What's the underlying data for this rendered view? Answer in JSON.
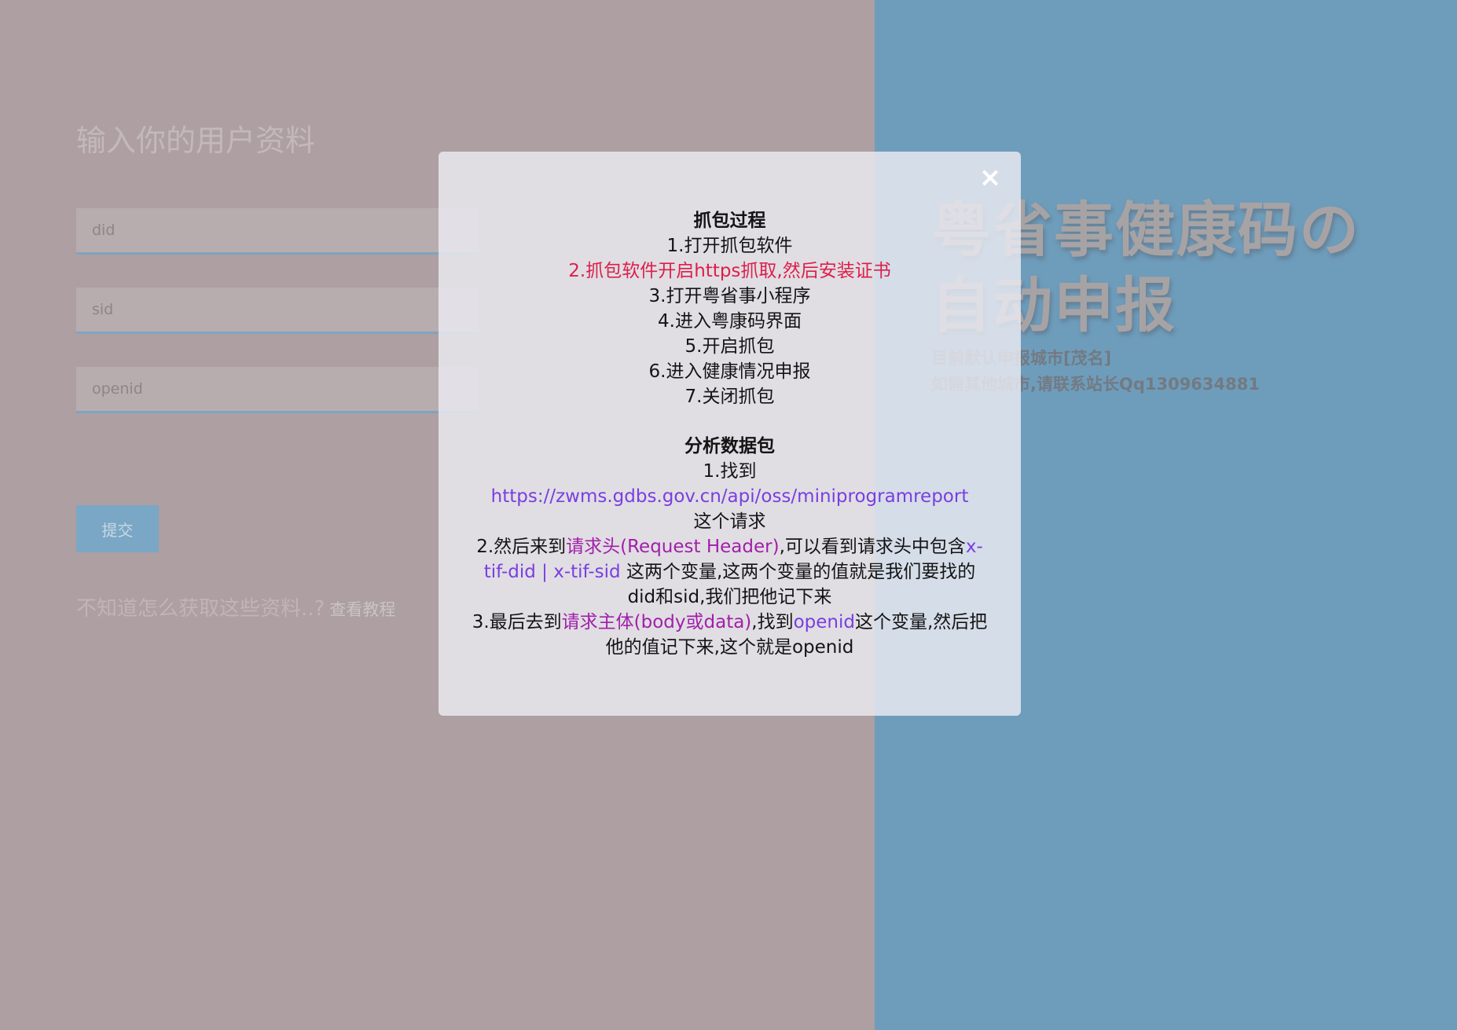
{
  "form": {
    "title": "输入你的用户资料",
    "did_placeholder": "did",
    "sid_placeholder": "sid",
    "openid_placeholder": "openid",
    "submit_label": "提交",
    "help_text": "不知道怎么获取这些资料..?",
    "help_link": "查看教程"
  },
  "hero": {
    "title": "粤省事健康码の自动申报",
    "line1": "目前默认申报城市[茂名]",
    "line2": "如需其他城市,请联系站长Qq1309634881"
  },
  "modal": {
    "close_label": "×",
    "section1": {
      "heading": "抓包过程",
      "steps": [
        "1.打开抓包软件",
        "2.抓包软件开启https抓取,然后安装证书",
        "3.打开粤省事小程序",
        "4.进入粤康码界面",
        "5.开启抓包",
        "6.进入健康情况申报",
        "7.关闭抓包"
      ]
    },
    "section2": {
      "heading": "分析数据包",
      "s1_prefix": "1.找到",
      "s1_url": "https://zwms.gdbs.gov.cn/api/oss/miniprogramreport",
      "s1_suffix": "这个请求",
      "s2_prefix": "2.然后来到",
      "s2_highlight": "请求头(Request Header)",
      "s2_mid": ",可以看到请求头中包含",
      "s2_vars": "x-tif-did | x-tif-sid",
      "s2_suffix": " 这两个变量,这两个变量的值就是我们要找的did和sid,我们把他记下来",
      "s3_prefix": "3.最后去到",
      "s3_highlight": "请求主体(body或data)",
      "s3_mid": ",找到",
      "s3_var": "openid",
      "s3_suffix": "这个变量,然后把他的值记下来,这个就是openid"
    }
  },
  "colors": {
    "left_bg": "#ad9fa2",
    "right_bg": "#6e9dbc",
    "highlight_red": "#dd1e4a",
    "highlight_purple": "#7a3ee0",
    "highlight_magenta": "#a21faa"
  }
}
